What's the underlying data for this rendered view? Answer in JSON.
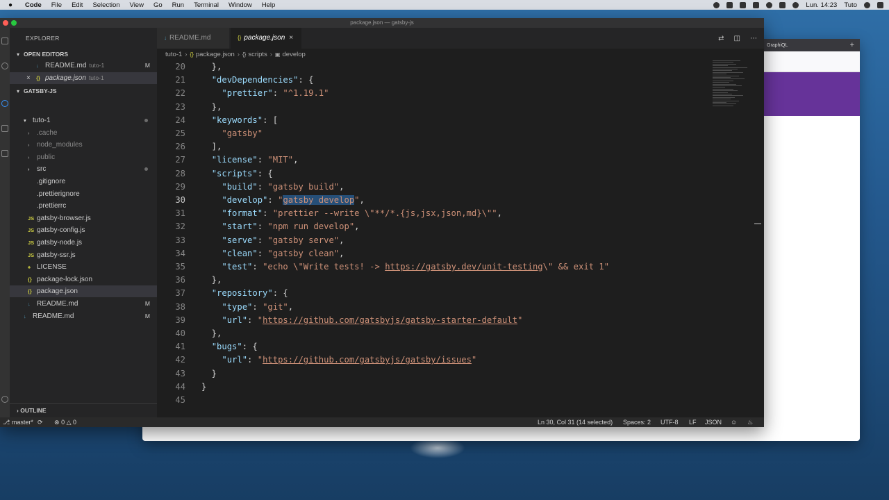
{
  "menubar": {
    "app": "Code",
    "items": [
      "File",
      "Edit",
      "Selection",
      "View",
      "Go",
      "Run",
      "Terminal",
      "Window",
      "Help"
    ],
    "clock": "Lun. 14:23",
    "user": "Tuto"
  },
  "browser": {
    "tab_label": "GraphiQL",
    "accent": "#663399"
  },
  "window": {
    "title": "package.json — gatsby-js"
  },
  "sidebar": {
    "title": "EXPLORER",
    "open_editors_label": "OPEN EDITORS",
    "open_editors": [
      {
        "name": "README.md",
        "folder": "tuto-1",
        "badge": "M",
        "icon": "markdown-icon"
      },
      {
        "name": "package.json",
        "folder": "tuto-1",
        "badge": "",
        "icon": "json-icon"
      }
    ],
    "workspace_label": "GATSBY-JS",
    "tree": [
      {
        "name": "tuto-1",
        "kind": "folder-open",
        "indent": 1
      },
      {
        "name": ".cache",
        "kind": "folder",
        "indent": 2
      },
      {
        "name": "node_modules",
        "kind": "folder",
        "indent": 2
      },
      {
        "name": "public",
        "kind": "folder",
        "indent": 2
      },
      {
        "name": "src",
        "kind": "folder",
        "indent": 2
      },
      {
        "name": ".gitignore",
        "kind": "file",
        "indent": 2
      },
      {
        "name": ".prettierignore",
        "kind": "file",
        "indent": 2
      },
      {
        "name": ".prettierrc",
        "kind": "file",
        "indent": 2
      },
      {
        "name": "gatsby-browser.js",
        "kind": "js",
        "indent": 2
      },
      {
        "name": "gatsby-config.js",
        "kind": "js",
        "indent": 2
      },
      {
        "name": "gatsby-node.js",
        "kind": "js",
        "indent": 2
      },
      {
        "name": "gatsby-ssr.js",
        "kind": "js",
        "indent": 2
      },
      {
        "name": "LICENSE",
        "kind": "license",
        "indent": 2
      },
      {
        "name": "package-lock.json",
        "kind": "json",
        "indent": 2
      },
      {
        "name": "package.json",
        "kind": "json",
        "indent": 2
      },
      {
        "name": "README.md",
        "kind": "md",
        "indent": 2,
        "badge": "M"
      },
      {
        "name": "README.md",
        "kind": "md",
        "indent": 1,
        "badge": "M"
      }
    ],
    "outline_label": "OUTLINE"
  },
  "editor": {
    "tabs": [
      {
        "label": "README.md",
        "active": false
      },
      {
        "label": "package.json",
        "active": true
      }
    ],
    "breadcrumb": [
      "tuto-1",
      "package.json",
      "scripts",
      "develop"
    ],
    "lines": [
      {
        "n": "20",
        "t": [
          [
            "p",
            "  },"
          ]
        ]
      },
      {
        "n": "21",
        "t": [
          [
            "p",
            "  "
          ],
          [
            "k",
            "\"devDependencies\""
          ],
          [
            "p",
            ": {"
          ]
        ]
      },
      {
        "n": "22",
        "t": [
          [
            "p",
            "    "
          ],
          [
            "k",
            "\"prettier\""
          ],
          [
            "p",
            ": "
          ],
          [
            "s",
            "\"^1.19.1\""
          ]
        ]
      },
      {
        "n": "23",
        "t": [
          [
            "p",
            "  },"
          ]
        ]
      },
      {
        "n": "24",
        "t": [
          [
            "p",
            "  "
          ],
          [
            "k",
            "\"keywords\""
          ],
          [
            "p",
            ": ["
          ]
        ]
      },
      {
        "n": "25",
        "t": [
          [
            "p",
            "    "
          ],
          [
            "s",
            "\"gatsby\""
          ]
        ]
      },
      {
        "n": "26",
        "t": [
          [
            "p",
            "  ],"
          ]
        ]
      },
      {
        "n": "27",
        "t": [
          [
            "p",
            "  "
          ],
          [
            "k",
            "\"license\""
          ],
          [
            "p",
            ": "
          ],
          [
            "s",
            "\"MIT\""
          ],
          [
            "p",
            ","
          ]
        ]
      },
      {
        "n": "28",
        "t": [
          [
            "p",
            "  "
          ],
          [
            "k",
            "\"scripts\""
          ],
          [
            "p",
            ": {"
          ]
        ]
      },
      {
        "n": "29",
        "t": [
          [
            "p",
            "    "
          ],
          [
            "k",
            "\"build\""
          ],
          [
            "p",
            ": "
          ],
          [
            "s",
            "\"gatsby build\""
          ],
          [
            "p",
            ","
          ]
        ]
      },
      {
        "n": "30",
        "t": [
          [
            "p",
            "    "
          ],
          [
            "k",
            "\"develop\""
          ],
          [
            "p",
            ": "
          ],
          [
            "s",
            "\""
          ],
          [
            "sel",
            "gatsby develop"
          ],
          [
            "s",
            "\""
          ],
          [
            "p",
            ","
          ]
        ]
      },
      {
        "n": "31",
        "t": [
          [
            "p",
            "    "
          ],
          [
            "k",
            "\"format\""
          ],
          [
            "p",
            ": "
          ],
          [
            "s",
            "\"prettier --write \\\"**/*.{js,jsx,json,md}\\\"\""
          ],
          [
            "p",
            ","
          ]
        ]
      },
      {
        "n": "32",
        "t": [
          [
            "p",
            "    "
          ],
          [
            "k",
            "\"start\""
          ],
          [
            "p",
            ": "
          ],
          [
            "s",
            "\"npm run develop\""
          ],
          [
            "p",
            ","
          ]
        ]
      },
      {
        "n": "33",
        "t": [
          [
            "p",
            "    "
          ],
          [
            "k",
            "\"serve\""
          ],
          [
            "p",
            ": "
          ],
          [
            "s",
            "\"gatsby serve\""
          ],
          [
            "p",
            ","
          ]
        ]
      },
      {
        "n": "34",
        "t": [
          [
            "p",
            "    "
          ],
          [
            "k",
            "\"clean\""
          ],
          [
            "p",
            ": "
          ],
          [
            "s",
            "\"gatsby clean\""
          ],
          [
            "p",
            ","
          ]
        ]
      },
      {
        "n": "35",
        "t": [
          [
            "p",
            "    "
          ],
          [
            "k",
            "\"test\""
          ],
          [
            "p",
            ": "
          ],
          [
            "s",
            "\"echo \\\"Write tests! -> "
          ],
          [
            "su",
            "https://gatsby.dev/unit-testing"
          ],
          [
            "s",
            "\\\" && exit 1\""
          ]
        ]
      },
      {
        "n": "36",
        "t": [
          [
            "p",
            "  },"
          ]
        ]
      },
      {
        "n": "37",
        "t": [
          [
            "p",
            "  "
          ],
          [
            "k",
            "\"repository\""
          ],
          [
            "p",
            ": {"
          ]
        ]
      },
      {
        "n": "38",
        "t": [
          [
            "p",
            "    "
          ],
          [
            "k",
            "\"type\""
          ],
          [
            "p",
            ": "
          ],
          [
            "s",
            "\"git\""
          ],
          [
            "p",
            ","
          ]
        ]
      },
      {
        "n": "39",
        "t": [
          [
            "p",
            "    "
          ],
          [
            "k",
            "\"url\""
          ],
          [
            "p",
            ": "
          ],
          [
            "s",
            "\""
          ],
          [
            "su",
            "https://github.com/gatsbyjs/gatsby-starter-default"
          ],
          [
            "s",
            "\""
          ]
        ]
      },
      {
        "n": "40",
        "t": [
          [
            "p",
            "  },"
          ]
        ]
      },
      {
        "n": "41",
        "t": [
          [
            "p",
            "  "
          ],
          [
            "k",
            "\"bugs\""
          ],
          [
            "p",
            ": {"
          ]
        ]
      },
      {
        "n": "42",
        "t": [
          [
            "p",
            "    "
          ],
          [
            "k",
            "\"url\""
          ],
          [
            "p",
            ": "
          ],
          [
            "s",
            "\""
          ],
          [
            "su",
            "https://github.com/gatsbyjs/gatsby/issues"
          ],
          [
            "s",
            "\""
          ]
        ]
      },
      {
        "n": "43",
        "t": [
          [
            "p",
            "  }"
          ]
        ]
      },
      {
        "n": "44",
        "t": [
          [
            "p",
            "}"
          ]
        ]
      },
      {
        "n": "45",
        "t": [
          [
            "p",
            ""
          ]
        ]
      }
    ],
    "current_line": "30"
  },
  "statusbar": {
    "branch": "master*",
    "problems": "0",
    "warnings": "0",
    "position": "Ln 30, Col 31 (14 selected)",
    "spaces": "Spaces: 2",
    "encoding": "UTF-8",
    "eol": "LF",
    "language": "JSON"
  },
  "colors": {
    "key": "#9cdcfe",
    "string": "#ce9178",
    "selection": "#264f78"
  }
}
